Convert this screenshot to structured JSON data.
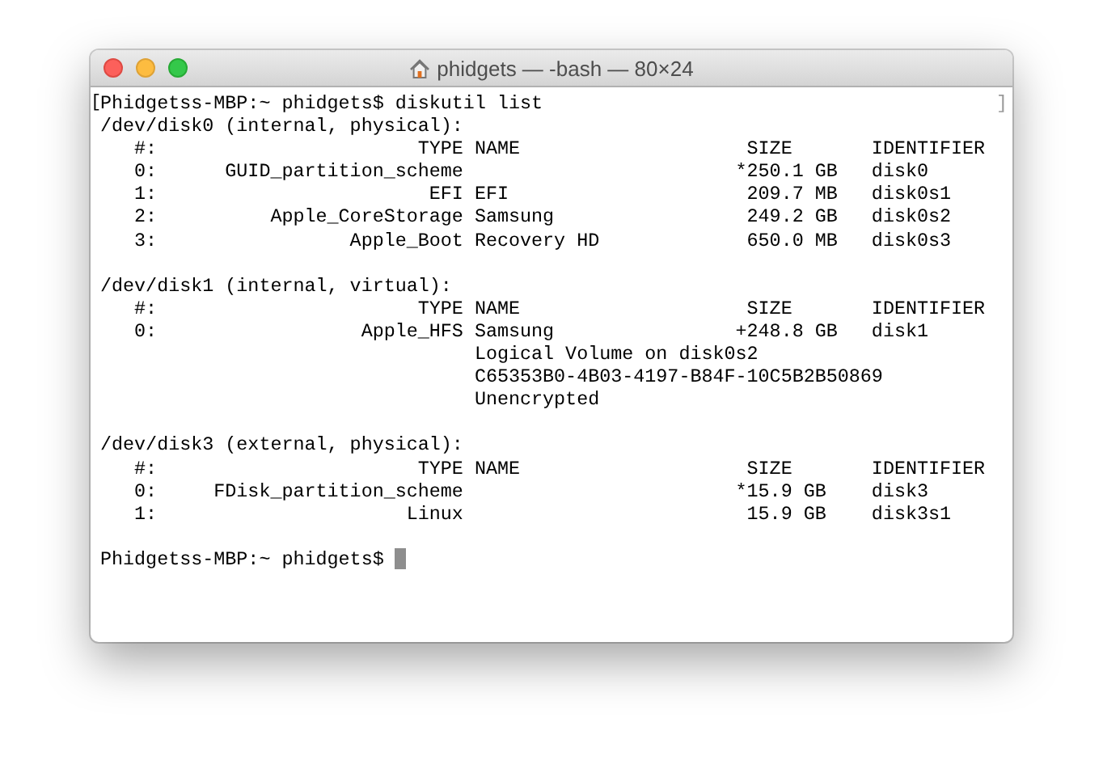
{
  "window": {
    "title": "phidgets — -bash — 80×24"
  },
  "terminal": {
    "open_mark": "[",
    "close_mark": "]",
    "blocks": [
      {
        "lines": [
          "Phidgetss-MBP:~ phidgets$ diskutil list",
          "/dev/disk0 (internal, physical):",
          "   #:                       TYPE NAME                    SIZE       IDENTIFIER",
          "   0:      GUID_partition_scheme                        *250.1 GB   disk0",
          "   1:                        EFI EFI                     209.7 MB   disk0s1",
          "   2:          Apple_CoreStorage Samsung                 249.2 GB   disk0s2",
          "   3:                 Apple_Boot Recovery HD             650.0 MB   disk0s3"
        ]
      },
      {
        "lines": [
          "/dev/disk1 (internal, virtual):",
          "   #:                       TYPE NAME                    SIZE       IDENTIFIER",
          "   0:                  Apple_HFS Samsung                +248.8 GB   disk1",
          "                                 Logical Volume on disk0s2",
          "                                 C65353B0-4B03-4197-B84F-10C5B2B50869",
          "                                 Unencrypted"
        ]
      },
      {
        "lines": [
          "/dev/disk3 (external, physical):",
          "   #:                       TYPE NAME                    SIZE       IDENTIFIER",
          "   0:     FDisk_partition_scheme                        *15.9 GB    disk3",
          "   1:                      Linux                         15.9 GB    disk3s1"
        ]
      }
    ],
    "prompt": "Phidgetss-MBP:~ phidgets$"
  }
}
